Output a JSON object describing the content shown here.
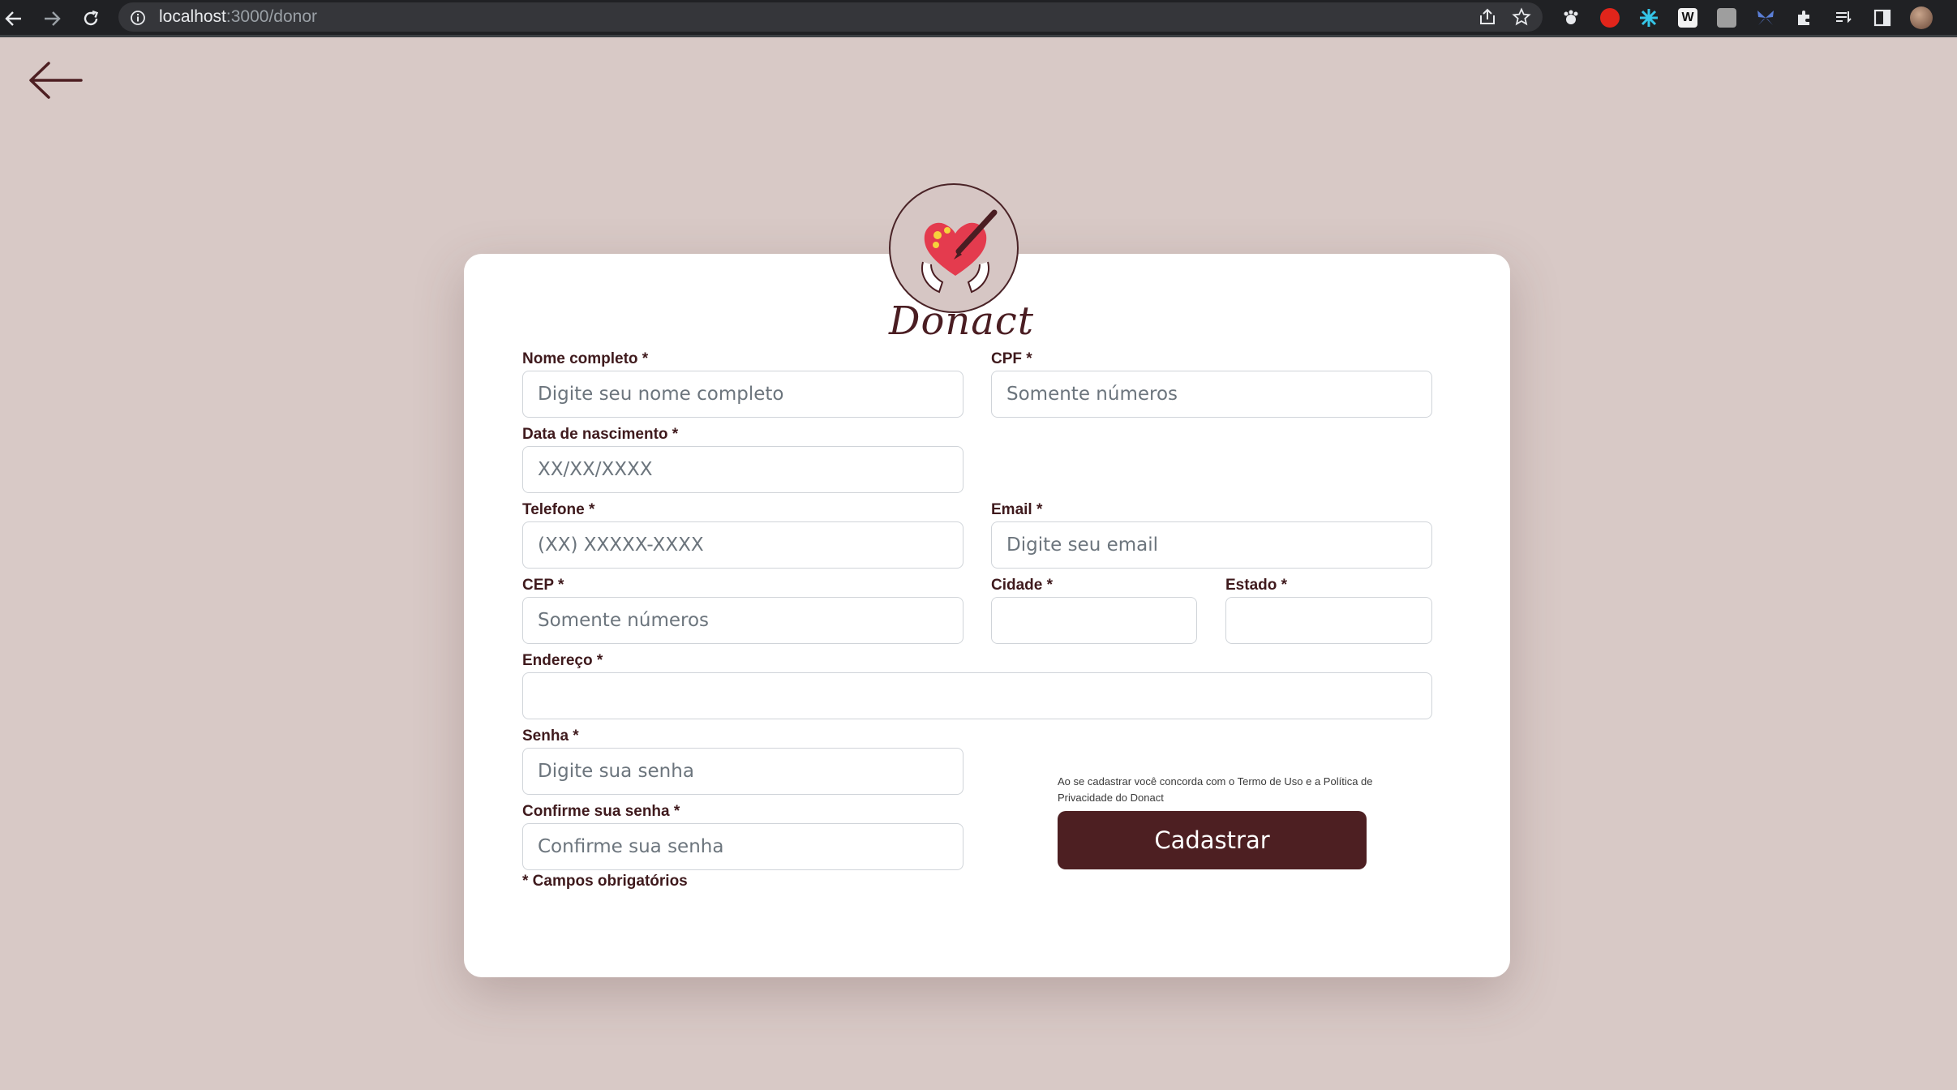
{
  "browser": {
    "url_host": "localhost",
    "url_rest": ":3000/donor"
  },
  "logo": {
    "text": "Donact"
  },
  "form": {
    "full_name": {
      "label": "Nome completo *",
      "placeholder": "Digite seu nome completo"
    },
    "cpf": {
      "label": "CPF *",
      "placeholder": "Somente números"
    },
    "birth_date": {
      "label": "Data de nascimento *",
      "placeholder": "XX/XX/XXXX"
    },
    "phone": {
      "label": "Telefone *",
      "placeholder": "(XX) XXXXX-XXXX"
    },
    "email": {
      "label": "Email *",
      "placeholder": "Digite seu email"
    },
    "cep": {
      "label": "CEP *",
      "placeholder": "Somente números"
    },
    "city": {
      "label": "Cidade *",
      "placeholder": ""
    },
    "state": {
      "label": "Estado *",
      "placeholder": ""
    },
    "address": {
      "label": "Endereço *",
      "placeholder": ""
    },
    "password": {
      "label": "Senha *",
      "placeholder": "Digite sua senha"
    },
    "confirm_password": {
      "label": "Confirme sua senha *",
      "placeholder": "Confirme sua senha"
    },
    "terms_text": "Ao se cadastrar você concorda com o Termo de Uso e a Política de Privacidade do Donact",
    "submit_label": "Cadastrar",
    "required_note": "* Campos obrigatórios"
  },
  "colors": {
    "background": "#d8c9c6",
    "accent": "#4d1f22",
    "label": "#3f1a1d"
  }
}
